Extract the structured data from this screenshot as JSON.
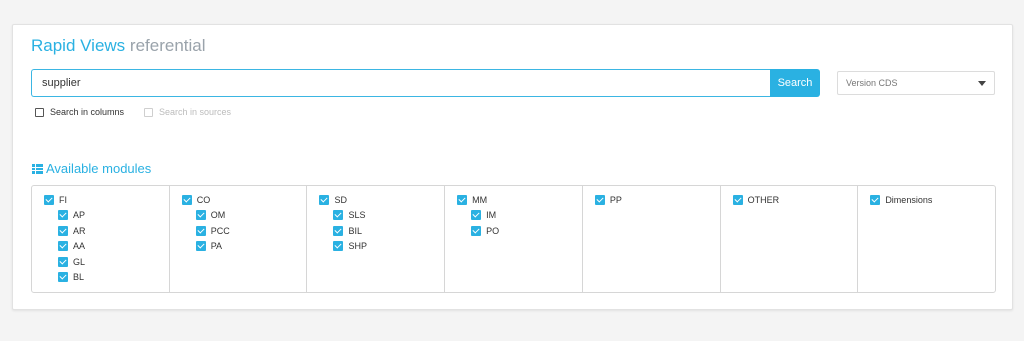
{
  "header": {
    "title_main": "Rapid Views",
    "title_sub": "referential"
  },
  "search": {
    "value": "supplier",
    "placeholder": "",
    "button_label": "Search"
  },
  "version": {
    "selected": "Version CDS"
  },
  "options": {
    "search_in_columns": {
      "label": "Search in columns",
      "checked": false,
      "enabled": true
    },
    "search_in_sources": {
      "label": "Search in sources",
      "checked": false,
      "enabled": false
    }
  },
  "modules": {
    "title": "Available modules",
    "accent_color": "#2ab1e2",
    "groups": [
      {
        "label": "FI",
        "checked": true,
        "children": [
          {
            "label": "AP",
            "checked": true
          },
          {
            "label": "AR",
            "checked": true
          },
          {
            "label": "AA",
            "checked": true
          },
          {
            "label": "GL",
            "checked": true
          },
          {
            "label": "BL",
            "checked": true
          }
        ]
      },
      {
        "label": "CO",
        "checked": true,
        "children": [
          {
            "label": "OM",
            "checked": true
          },
          {
            "label": "PCC",
            "checked": true
          },
          {
            "label": "PA",
            "checked": true
          }
        ]
      },
      {
        "label": "SD",
        "checked": true,
        "children": [
          {
            "label": "SLS",
            "checked": true
          },
          {
            "label": "BIL",
            "checked": true
          },
          {
            "label": "SHP",
            "checked": true
          }
        ]
      },
      {
        "label": "MM",
        "checked": true,
        "children": [
          {
            "label": "IM",
            "checked": true
          },
          {
            "label": "PO",
            "checked": true
          }
        ]
      },
      {
        "label": "PP",
        "checked": true,
        "children": []
      },
      {
        "label": "OTHER",
        "checked": true,
        "children": []
      },
      {
        "label": "Dimensions",
        "checked": true,
        "children": []
      }
    ]
  }
}
